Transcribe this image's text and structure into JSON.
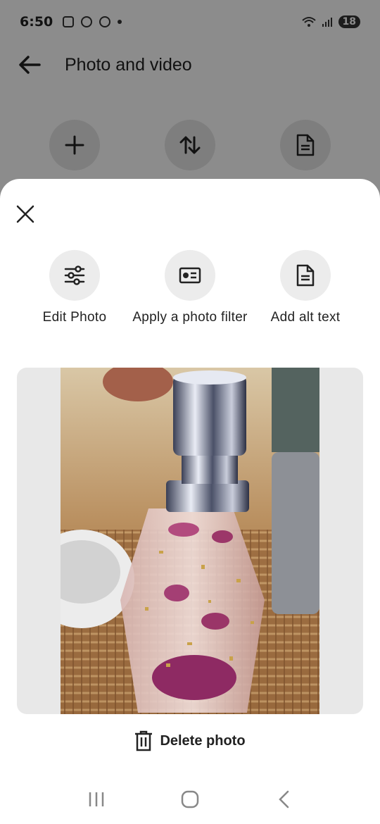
{
  "status_bar": {
    "time": "6:50",
    "battery": "18",
    "icons": [
      "screenshot-icon",
      "chrome-icon",
      "chrome-icon",
      "dot-icon",
      "wifi-icon",
      "signal-icon",
      "battery-icon"
    ]
  },
  "header": {
    "title": "Photo and video",
    "back_icon": "arrow-left-icon"
  },
  "toolbar": {
    "icons": [
      "plus-icon",
      "sort-icon",
      "document-icon"
    ]
  },
  "sheet": {
    "close_icon": "close-icon",
    "actions": [
      {
        "label": "Edit Photo",
        "icon": "sliders-icon"
      },
      {
        "label": "Apply a photo filter",
        "icon": "filter-card-icon"
      },
      {
        "label": "Add alt text",
        "icon": "document-icon"
      }
    ],
    "delete_label": "Delete photo",
    "delete_icon": "trash-icon"
  },
  "nav_bar": {
    "icons": [
      "recent-apps-icon",
      "home-icon",
      "back-icon"
    ]
  },
  "colors": {
    "scrim": "#000000",
    "sheet_bg": "#ffffff",
    "circle_bg": "#ececec",
    "photo_frame_bg": "#e8e8e8"
  }
}
